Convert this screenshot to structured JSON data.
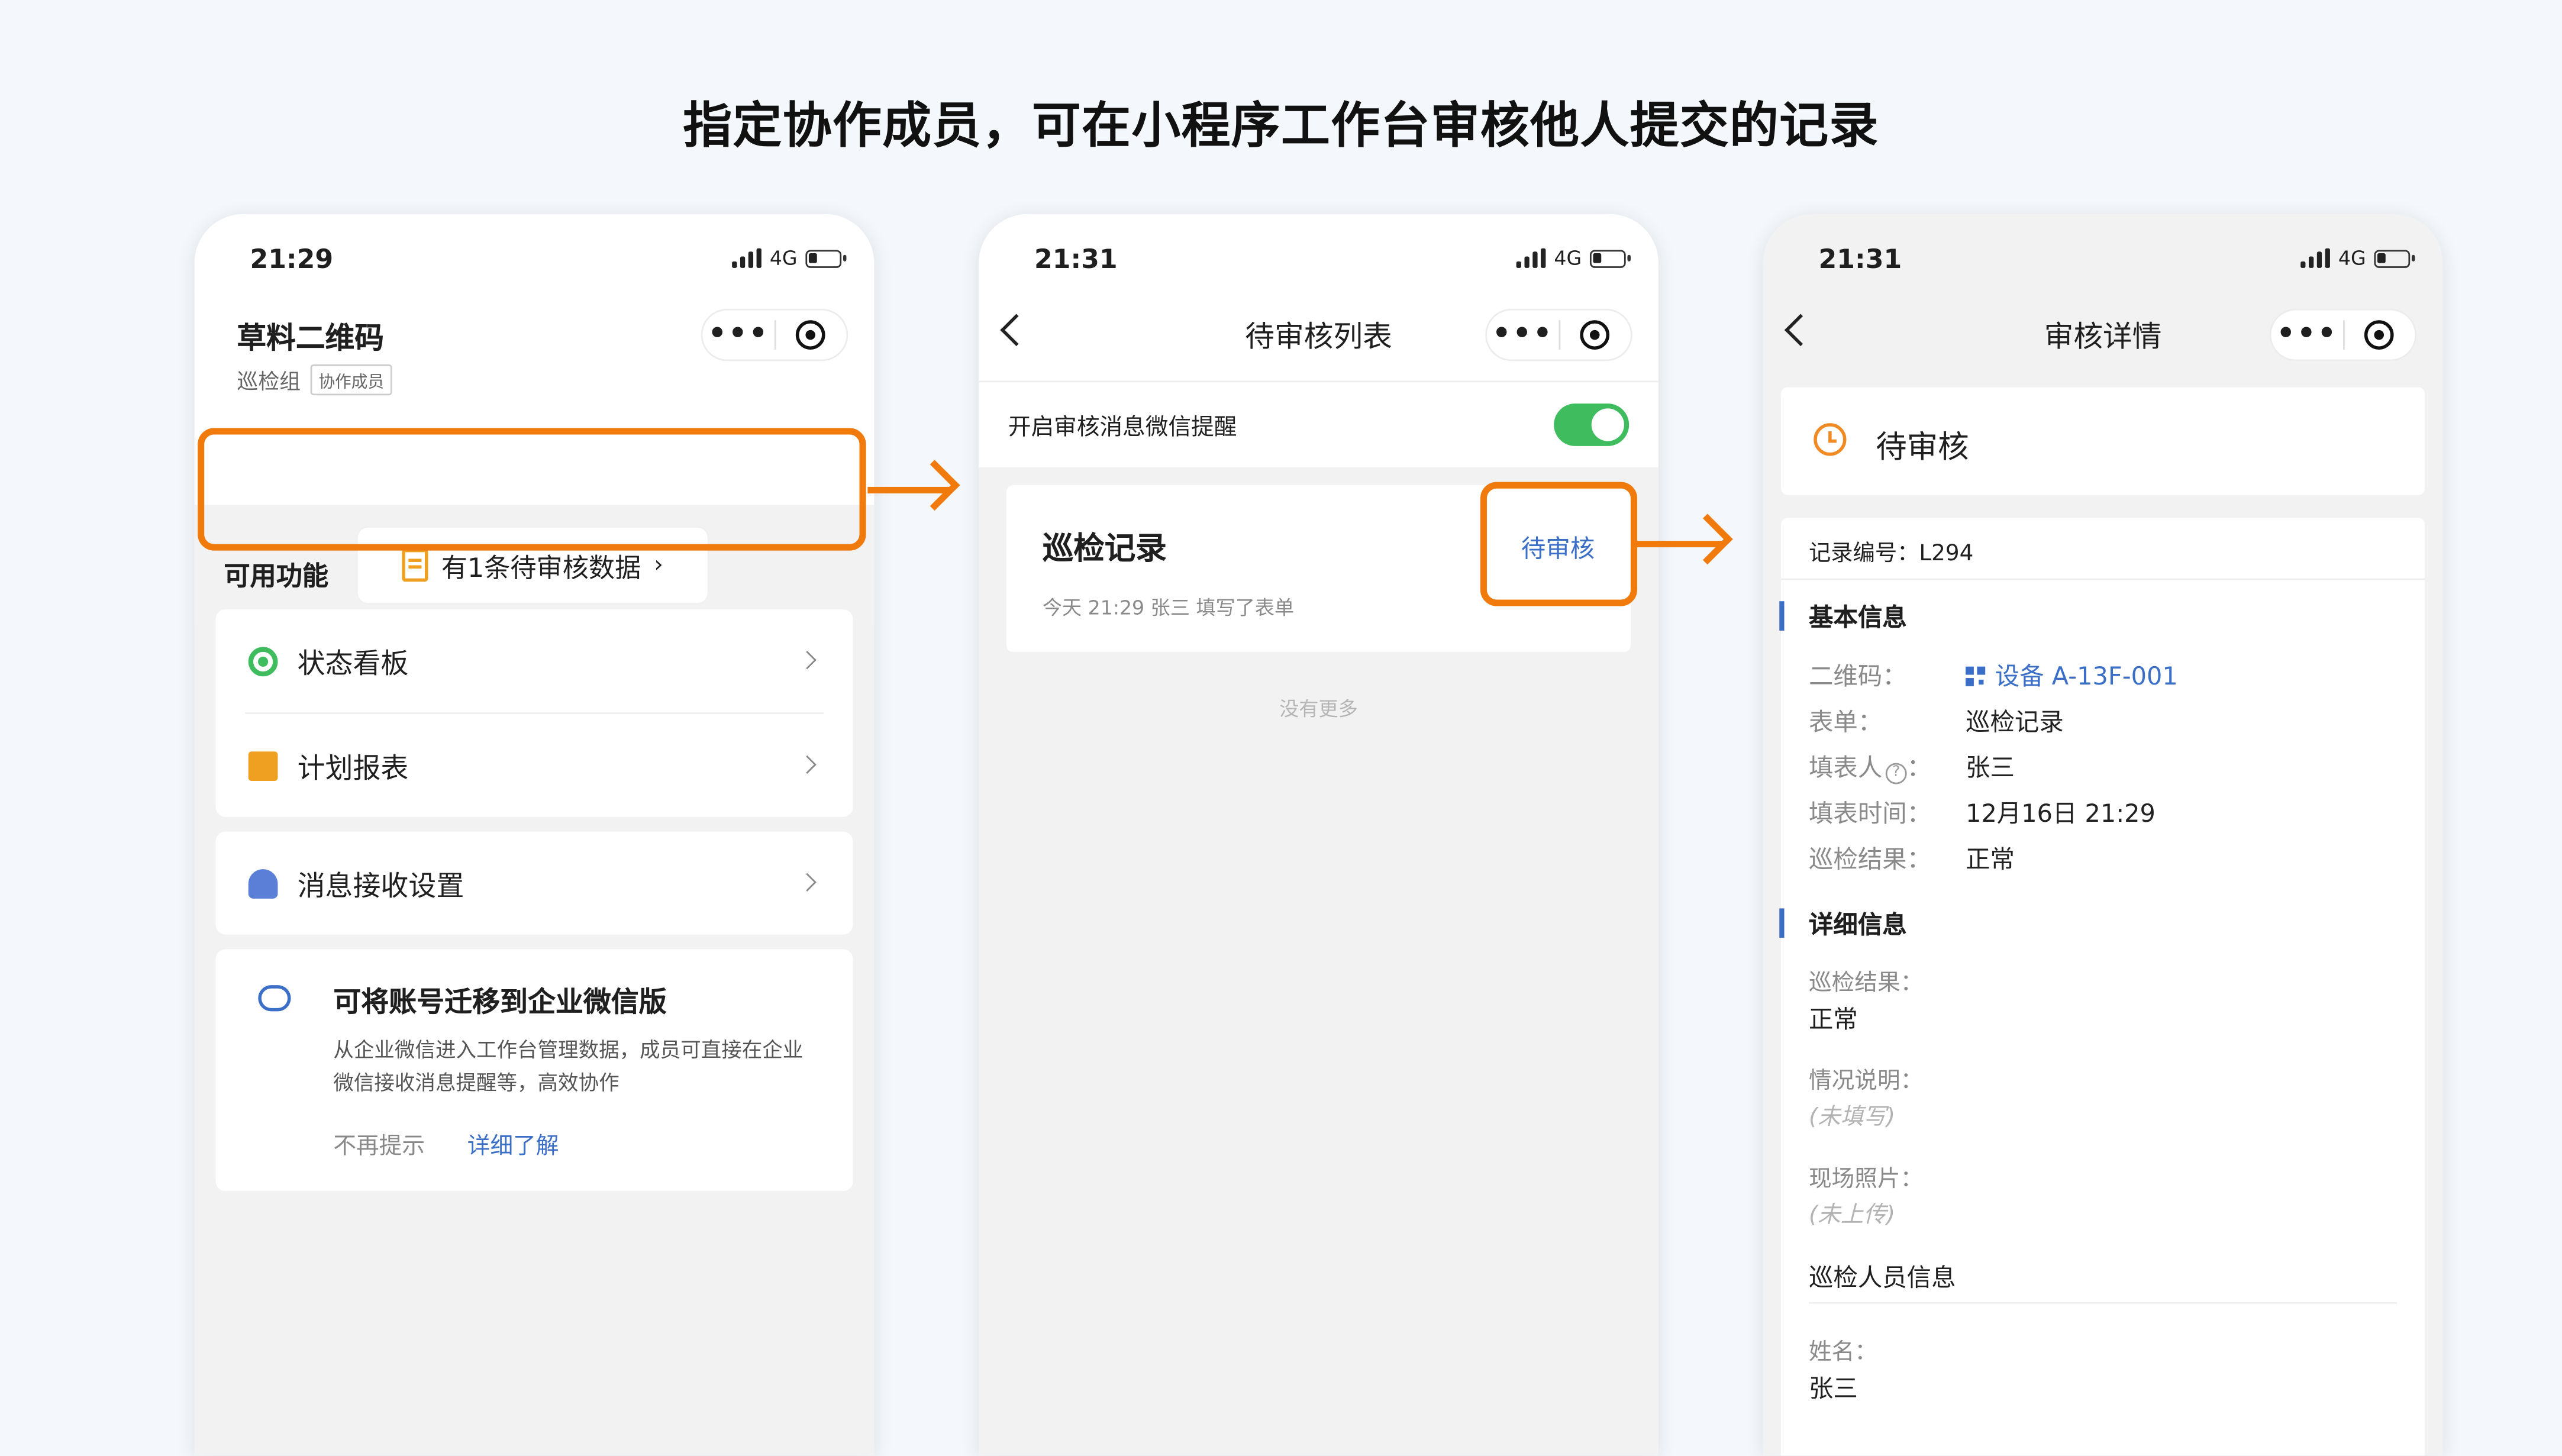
{
  "headline": "指定协作成员，可在小程序工作台审核他人提交的记录",
  "accent_color": "#f07a0c",
  "phone1": {
    "time": "21:29",
    "network": "4G",
    "app_title": "草料二维码",
    "group": "巡检组",
    "role_tag": "协作成员",
    "pending_text": "有1条待审核数据",
    "section_label": "可用功能",
    "menu": [
      {
        "label": "状态看板",
        "icon": "status-board-icon"
      },
      {
        "label": "计划报表",
        "icon": "clipboard-check-icon"
      },
      {
        "label": "消息接收设置",
        "icon": "bell-icon"
      }
    ],
    "migrate": {
      "title": "可将账号迁移到企业微信版",
      "desc": "从企业微信进入工作台管理数据，成员可直接在企业微信接收消息提醒等，高效协作",
      "dismiss": "不再提示",
      "learn_more": "详细了解"
    }
  },
  "phone2": {
    "time": "21:31",
    "network": "4G",
    "nav_title": "待审核列表",
    "toggle_label": "开启审核消息微信提醒",
    "toggle_on": true,
    "record": {
      "title": "巡检记录",
      "meta": "今天 21:29  张三 填写了表单",
      "status": "待审核"
    },
    "no_more": "没有更多"
  },
  "phone3": {
    "time": "21:31",
    "network": "4G",
    "nav_title": "审核详情",
    "status": "待审核",
    "record_no": "记录编号：L294",
    "basic_title": "基本信息",
    "basic": {
      "qr_key": "二维码：",
      "qr_val": "设备 A-13F-001",
      "form_key": "表单：",
      "form_val": "巡检记录",
      "filler_key": "填表人",
      "filler_val": "张三",
      "time_key": "填表时间：",
      "time_val": "12月16日 21:29",
      "result_key": "巡检结果：",
      "result_val": "正常"
    },
    "detail_title": "详细信息",
    "detail": {
      "result_key": "巡检结果：",
      "result_val": "正常",
      "note_key": "情况说明：",
      "note_val": "(未填写)",
      "photo_key": "现场照片：",
      "photo_val": "(未上传)"
    },
    "inspector_title": "巡检人员信息",
    "inspector": {
      "name_key": "姓名：",
      "name_val": "张三"
    }
  }
}
